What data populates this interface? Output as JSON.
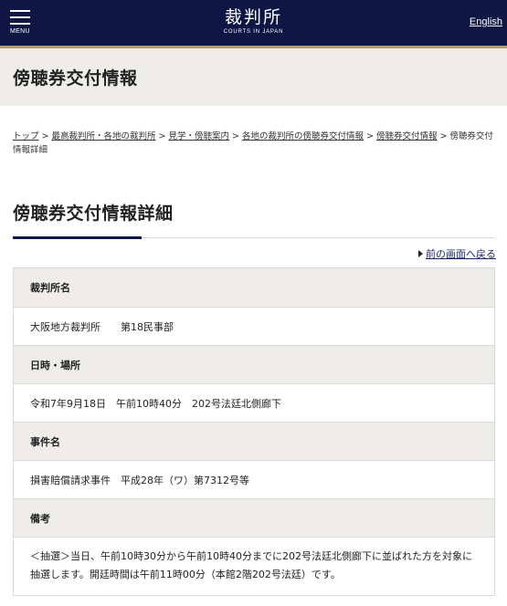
{
  "header": {
    "menu_label": "MENU",
    "logo_main": "裁判所",
    "logo_sub": "COURTS IN JAPAN",
    "english_link": "English"
  },
  "page_title": "傍聴券交付情報",
  "breadcrumb": {
    "items": [
      "トップ",
      "最高裁判所・各地の裁判所",
      "見学・傍聴案内",
      "各地の裁判所の傍聴券交付情報",
      "傍聴券交付情報"
    ],
    "separator": ">",
    "current": "傍聴券交付情報詳細"
  },
  "detail_title": "傍聴券交付情報詳細",
  "back_link": "前の画面へ戻る",
  "details": {
    "court_label": "裁判所名",
    "court_value": "大阪地方裁判所　　第18民事部",
    "datetime_label": "日時・場所",
    "datetime_value": "令和7年9月18日　午前10時40分　202号法廷北側廊下",
    "case_label": "事件名",
    "case_value": "損害賠償請求事件　平成28年（ワ）第7312号等",
    "notes_label": "備考",
    "notes_value": "＜抽選＞当日、午前10時30分から午前10時40分までに202号法廷北側廊下に並ばれた方を対象に抽選します。開廷時間は午前11時00分（本館2階202号法廷）です。"
  },
  "colors": {
    "header_bg": "#0d1645",
    "header_accent": "#b59a6a",
    "band_bg": "#efedea"
  }
}
